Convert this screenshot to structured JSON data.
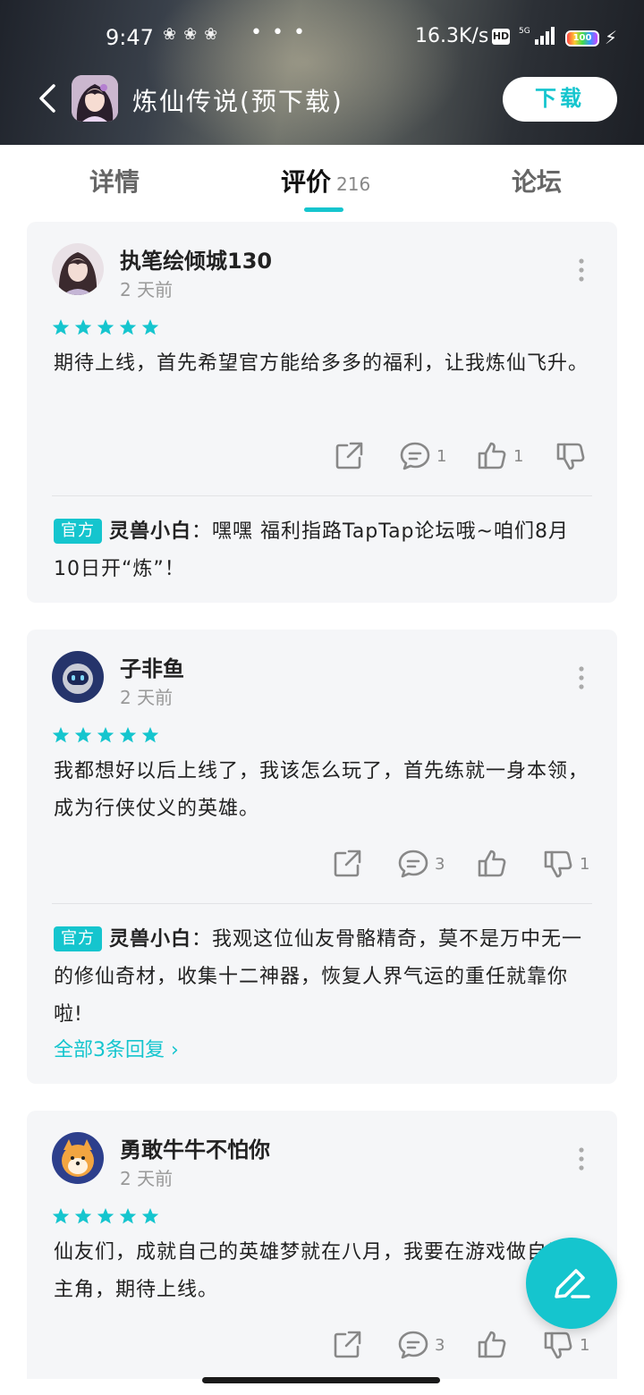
{
  "status_bar": {
    "time": "9:47",
    "more": "• • •",
    "net_speed": "16.3K/s",
    "hd": "HD",
    "network": "5G",
    "battery": "100"
  },
  "header": {
    "title": "炼仙传说(预下载)",
    "download_label": "下载",
    "accent_color": "#15c5ce"
  },
  "tabs": {
    "detail": "详情",
    "review": "评价",
    "review_count": "216",
    "forum": "论坛"
  },
  "reviews": [
    {
      "username": "执笔绘倾城130",
      "time": "2 天前",
      "rating": 5,
      "content": "期待上线，首先希望官方能给多多的福利，让我炼仙飞升。",
      "comments": "1",
      "likes": "1",
      "dislikes": "",
      "reply": {
        "badge": "官方",
        "name": "灵兽小白",
        "separator": "：",
        "text": "嘿嘿 福利指路TapTap论坛哦~咱们8月10日开“炼”！"
      }
    },
    {
      "username": "子非鱼",
      "time": "2 天前",
      "rating": 5,
      "content": "我都想好以后上线了，我该怎么玩了，首先练就一身本领，成为行侠仗义的英雄。",
      "comments": "3",
      "likes": "",
      "dislikes": "1",
      "reply": {
        "badge": "官方",
        "name": "灵兽小白",
        "separator": "：",
        "text": "我观这位仙友骨骼精奇，莫不是万中无一的修仙奇材，收集十二神器，恢复人界气运的重任就靠你啦!"
      },
      "view_all": "全部3条回复 ›"
    },
    {
      "username": "勇敢牛牛不怕你",
      "time": "2 天前",
      "rating": 5,
      "content": "仙友们，成就自己的英雄梦就在八月，我要在游戏做自己的主角，期待上线。",
      "comments": "3",
      "likes": "",
      "dislikes": "1"
    }
  ]
}
